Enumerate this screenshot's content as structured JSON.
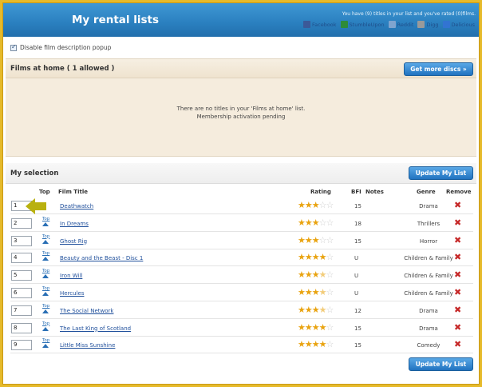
{
  "header": {
    "title": "My rental lists",
    "info": "You have (9) titles in your list and you've rated (0)films."
  },
  "share": [
    {
      "label": "Facebook",
      "icon": "facebook-icon",
      "color": "#3b5998"
    },
    {
      "label": "StumbleUpon",
      "icon": "stumbleupon-icon",
      "color": "#2e8b3a"
    },
    {
      "label": "Reddit",
      "icon": "reddit-icon",
      "color": "#7fa4cf"
    },
    {
      "label": "Digg",
      "icon": "digg-icon",
      "color": "#9a9a9a"
    },
    {
      "label": "Delicious",
      "icon": "delicious-icon",
      "color": "#3274d2"
    }
  ],
  "popup_toggle": {
    "label": "Disable film description popup",
    "checked": true
  },
  "home": {
    "title": "Films at home ( 1 allowed )",
    "button": "Get more discs »",
    "empty_line1": "There are no titles in your 'Films at home' list.",
    "empty_line2": "Membership activation pending"
  },
  "selection": {
    "title": "My selection",
    "update_label": "Update My List",
    "columns": {
      "top": "Top",
      "film": "Film Title",
      "rating": "Rating",
      "bfi": "BFI",
      "notes": "Notes",
      "genre": "Genre",
      "remove": "Remove"
    },
    "top_link": "Top",
    "rows": [
      {
        "pos": "1",
        "title": "Deathwatch",
        "rating": 3,
        "bfi": "15",
        "genre": "Drama",
        "show_top": false
      },
      {
        "pos": "2",
        "title": "In Dreams",
        "rating": 3,
        "bfi": "18",
        "genre": "Thrillers",
        "show_top": true
      },
      {
        "pos": "3",
        "title": "Ghost Rig",
        "rating": 3,
        "bfi": "15",
        "genre": "Horror",
        "show_top": true
      },
      {
        "pos": "4",
        "title": "Beauty and the Beast - Disc 1",
        "rating": 4,
        "bfi": "U",
        "genre": "Children & Family",
        "show_top": true
      },
      {
        "pos": "5",
        "title": "Iron Will",
        "rating": 3.5,
        "bfi": "U",
        "genre": "Children & Family",
        "show_top": true
      },
      {
        "pos": "6",
        "title": "Hercules",
        "rating": 3.5,
        "bfi": "U",
        "genre": "Children & Family",
        "show_top": true
      },
      {
        "pos": "7",
        "title": "The Social Network",
        "rating": 3.5,
        "bfi": "12",
        "genre": "Drama",
        "show_top": true
      },
      {
        "pos": "8",
        "title": "The Last King of Scotland",
        "rating": 4,
        "bfi": "15",
        "genre": "Drama",
        "show_top": true
      },
      {
        "pos": "9",
        "title": "Little Miss Sunshine",
        "rating": 4,
        "bfi": "15",
        "genre": "Comedy",
        "show_top": true
      }
    ]
  },
  "colors": {
    "accent": "#2a7fbf",
    "frame": "#e6ba2a",
    "remove": "#c62828",
    "star": "#e9a30f"
  }
}
